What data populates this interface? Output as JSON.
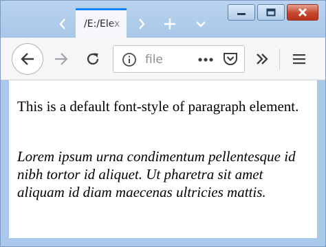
{
  "tab": {
    "title": "/E:/Elex"
  },
  "toolbar": {
    "url_text": "file"
  },
  "content": {
    "paragraph_normal": "This is a default font-style of paragraph element.",
    "paragraph_italic": "Lorem ipsum urna condimentum pellentesque id nibh tortor id aliquet. Ut pharetra sit amet aliquam id diam maecenas ultricies mattis."
  },
  "colors": {
    "tab_accent": "#0a84ff",
    "close_button": "#c7472f",
    "frame": "#aac9ea"
  }
}
